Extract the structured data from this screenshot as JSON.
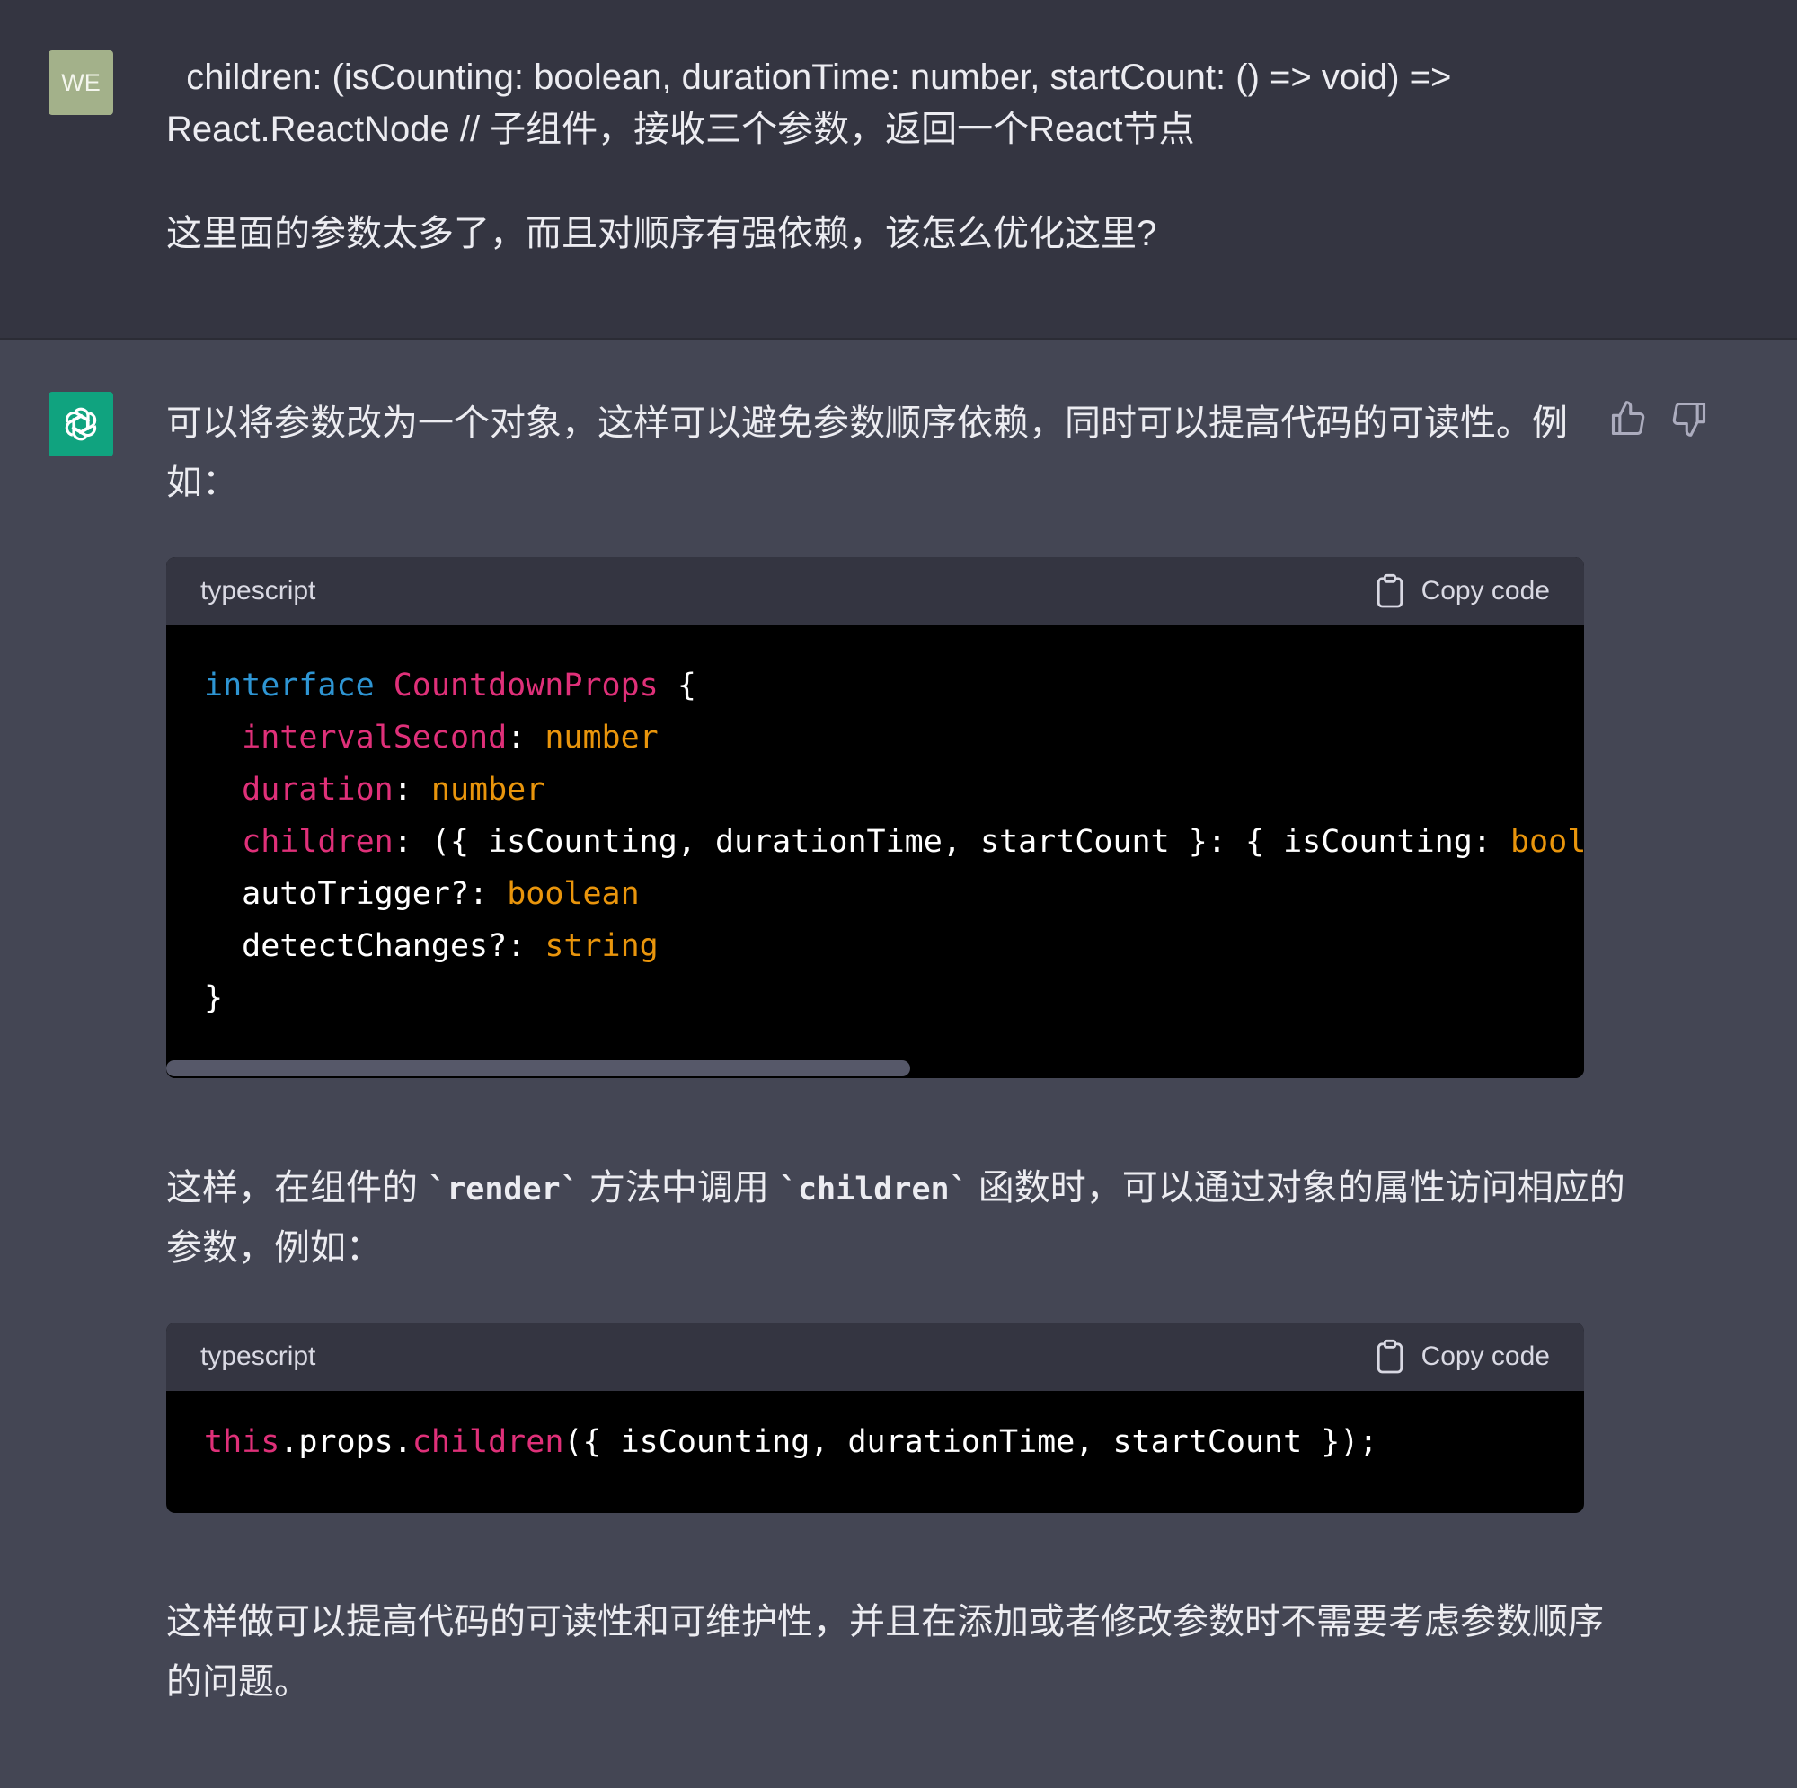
{
  "user": {
    "avatar": "WE",
    "line1": "  children: (isCounting: boolean, durationTime: number, startCount: () => void) =>",
    "line2": "React.ReactNode // 子组件，接收三个参数，返回一个React节点",
    "line3": "这里面的参数太多了，而且对顺序有强依赖，该怎么优化这里?"
  },
  "assistant": {
    "intro_line1": "可以将参数改为一个对象，这样可以避免参数顺序依赖，同时可以提高代码的可读性。例",
    "intro_line2": "如：",
    "code1": {
      "language": "typescript",
      "copy_label": "Copy code",
      "interface_kw": "interface",
      "interface_name": "CountdownProps",
      "open_brace": " {",
      "props": [
        {
          "name": "intervalSecond",
          "sep": ": ",
          "type": "number"
        },
        {
          "name": "duration",
          "sep": ": ",
          "type": "number"
        },
        {
          "name": "children",
          "sep": ": ({ isCounting, durationTime, startCount }: { isCounting: ",
          "type": "boolean"
        },
        {
          "name": "autoTrigger?",
          "sep": ": ",
          "type": "boolean"
        },
        {
          "name": "detectChanges?",
          "sep": ": ",
          "type": "string"
        }
      ],
      "close_brace": "}"
    },
    "mid_prefix": "这样，在组件的 ",
    "mid_code1": "`render`",
    "mid_middle": " 方法中调用 ",
    "mid_code2": "`children`",
    "mid_suffix": " 函数时，可以通过对象的属性访问相应的",
    "mid_line2": "参数，例如：",
    "code2": {
      "language": "typescript",
      "copy_label": "Copy code",
      "this_kw": "this",
      "dot_props": ".props.",
      "children_fn": "children",
      "args": "({ isCounting, durationTime, startCount });"
    },
    "outro_line1": "这样做可以提高代码的可读性和可维护性，并且在添加或者修改参数时不需要考虑参数顺序",
    "outro_line2": "的问题。"
  },
  "icons": {
    "thumbs_up": "thumbs-up-icon",
    "thumbs_down": "thumbs-down-icon",
    "clipboard": "clipboard-icon",
    "openai_logo": "openai-logo-icon"
  },
  "colors": {
    "keyword": "#2e95d3",
    "property": "#df3079",
    "type": "#e9950c",
    "assistant_avatar": "#10a37f",
    "user_avatar": "#a3b18a"
  }
}
